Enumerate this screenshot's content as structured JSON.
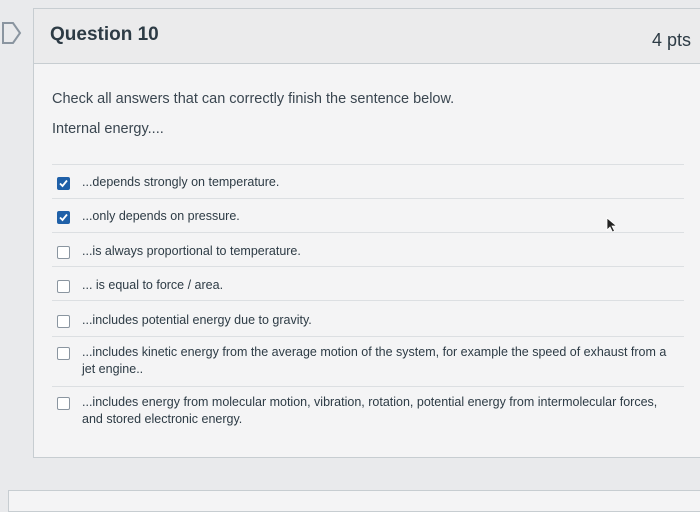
{
  "question": {
    "title": "Question 10",
    "points": "4 pts",
    "prompt": "Check all answers that can correctly finish the sentence below.",
    "stem": "Internal energy...."
  },
  "answers": [
    {
      "text": "...depends strongly on temperature.",
      "checked": true
    },
    {
      "text": "...only depends on pressure.",
      "checked": true
    },
    {
      "text": "...is always proportional to temperature.",
      "checked": false
    },
    {
      "text": "... is equal to force / area.",
      "checked": false
    },
    {
      "text": "...includes potential energy due to gravity.",
      "checked": false
    },
    {
      "text": "...includes kinetic energy from the average motion of the system, for example the speed of exhaust from a jet engine..",
      "checked": false
    },
    {
      "text": "...includes energy from molecular motion, vibration, rotation, potential energy from intermolecular forces, and stored electronic energy.",
      "checked": false
    }
  ],
  "colors": {
    "checked": "#1f60a8",
    "text": "#2d3b45",
    "background": "#e9eaec"
  },
  "icons": {
    "flag": "bookmark-flag-icon",
    "cursor": "mouse-pointer-icon"
  }
}
